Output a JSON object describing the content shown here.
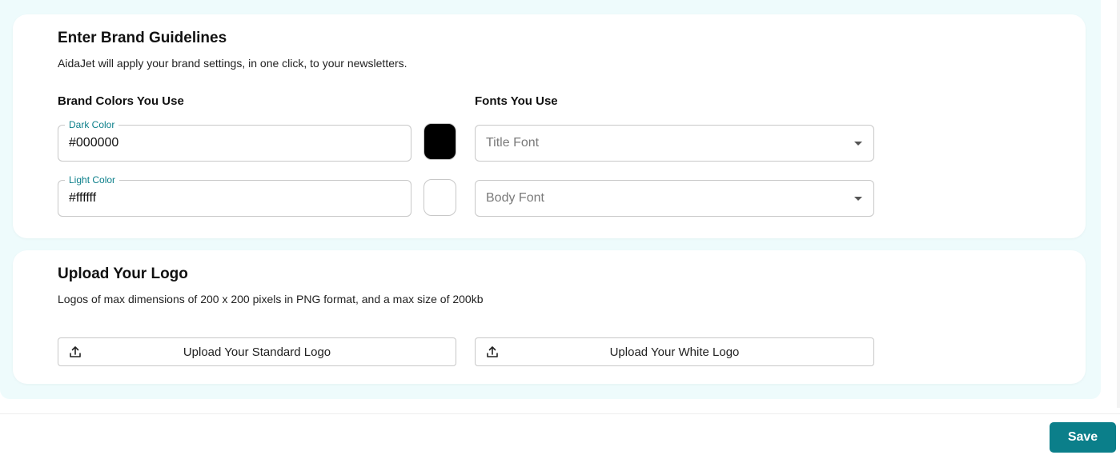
{
  "brand": {
    "title": "Enter Brand Guidelines",
    "subtitle": "AidaJet will apply your brand settings, in one click, to your newsletters.",
    "colors_label": "Brand Colors You Use",
    "fonts_label": "Fonts You Use",
    "dark_color": {
      "legend": "Dark Color",
      "value": "#000000"
    },
    "light_color": {
      "legend": "Light Color",
      "value": "#ffffff"
    },
    "title_font": {
      "placeholder": "Title Font"
    },
    "body_font": {
      "placeholder": "Body Font"
    }
  },
  "logo": {
    "title": "Upload Your Logo",
    "subtitle": "Logos of max dimensions of 200 x 200 pixels in PNG format, and a max size of 200kb",
    "standard_button": "Upload Your Standard Logo",
    "white_button": "Upload Your White Logo",
    "upload_icon": "upload-icon"
  },
  "footer": {
    "save_label": "Save"
  },
  "colors": {
    "accent": "#0b7f8a",
    "panel_background": "#eefbfc"
  }
}
